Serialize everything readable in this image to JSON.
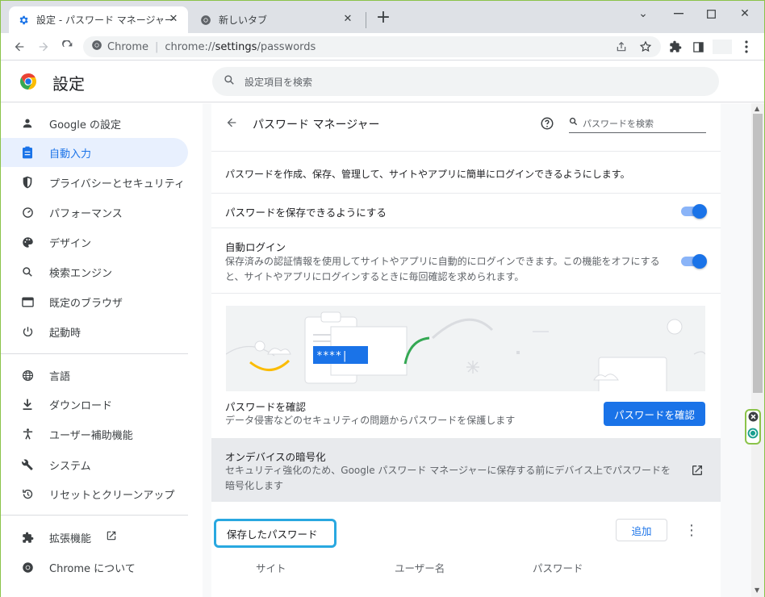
{
  "tabs": [
    {
      "label": "設定 - パスワード マネージャー",
      "icon": "gear-icon",
      "active": true
    },
    {
      "label": "新しいタブ",
      "icon": "chrome-icon",
      "active": false
    }
  ],
  "window_controls": {
    "minimize": "—",
    "maximize": "☐",
    "close": "✕",
    "tab_search": "⌄"
  },
  "newtab_symbol": "+",
  "omnibox": {
    "site": "Chrome",
    "separator": "|",
    "url_prefix": "chrome://",
    "url_host": "settings",
    "url_path": "/passwords"
  },
  "settings": {
    "title": "設定",
    "search_placeholder": "設定項目を検索"
  },
  "sidebar": {
    "items": [
      {
        "label": "Google の設定",
        "icon": "person-icon"
      },
      {
        "label": "自動入力",
        "icon": "clipboard-icon",
        "active": true
      },
      {
        "label": "プライバシーとセキュリティ",
        "icon": "shield-icon"
      },
      {
        "label": "パフォーマンス",
        "icon": "gauge-icon"
      },
      {
        "label": "デザイン",
        "icon": "palette-icon"
      },
      {
        "label": "検索エンジン",
        "icon": "search-icon"
      },
      {
        "label": "既定のブラウザ",
        "icon": "browser-icon"
      },
      {
        "label": "起動時",
        "icon": "power-icon"
      },
      {
        "label": "言語",
        "icon": "globe-icon"
      },
      {
        "label": "ダウンロード",
        "icon": "download-icon"
      },
      {
        "label": "ユーザー補助機能",
        "icon": "accessibility-icon"
      },
      {
        "label": "システム",
        "icon": "wrench-icon"
      },
      {
        "label": "リセットとクリーンアップ",
        "icon": "restore-icon"
      },
      {
        "label": "拡張機能",
        "icon": "puzzle-icon"
      },
      {
        "label": "Chrome について",
        "icon": "chrome-icon"
      }
    ]
  },
  "password_manager": {
    "title": "パスワード マネージャー",
    "search_placeholder": "パスワードを検索",
    "description": "パスワードを作成、保存、管理して、サイトやアプリに簡単にログインできるようにします。",
    "offer_to_save": {
      "label": "パスワードを保存できるようにする",
      "enabled": true
    },
    "auto_signin": {
      "label": "自動ログイン",
      "sub_line1": "保存済みの認証情報を使用してサイトやアプリに自動的にログインできます。この機能をオフにする",
      "sub_line2": "と、サイトやアプリにログインするときに毎回確認を求められます。",
      "enabled": true
    },
    "illustration_text": "****|",
    "check": {
      "label": "パスワードを確認",
      "sub": "データ侵害などのセキュリティの問題からパスワードを保護します",
      "button": "パスワードを確認"
    },
    "on_device": {
      "label": "オンデバイスの暗号化",
      "sub_line1": "セキュリティ強化のため、Google パスワード マネージャーに保存する前にデバイス上でパスワードを",
      "sub_line2": "暗号化します"
    },
    "saved": {
      "label": "保存したパスワード",
      "add_button": "追加",
      "more": "⋮",
      "columns": [
        "サイト",
        "ユーザー名",
        "パスワード"
      ]
    }
  },
  "colors": {
    "accent": "#1a73e8",
    "highlight": "#29a8e0",
    "active_nav_bg": "#e8f0fe"
  }
}
